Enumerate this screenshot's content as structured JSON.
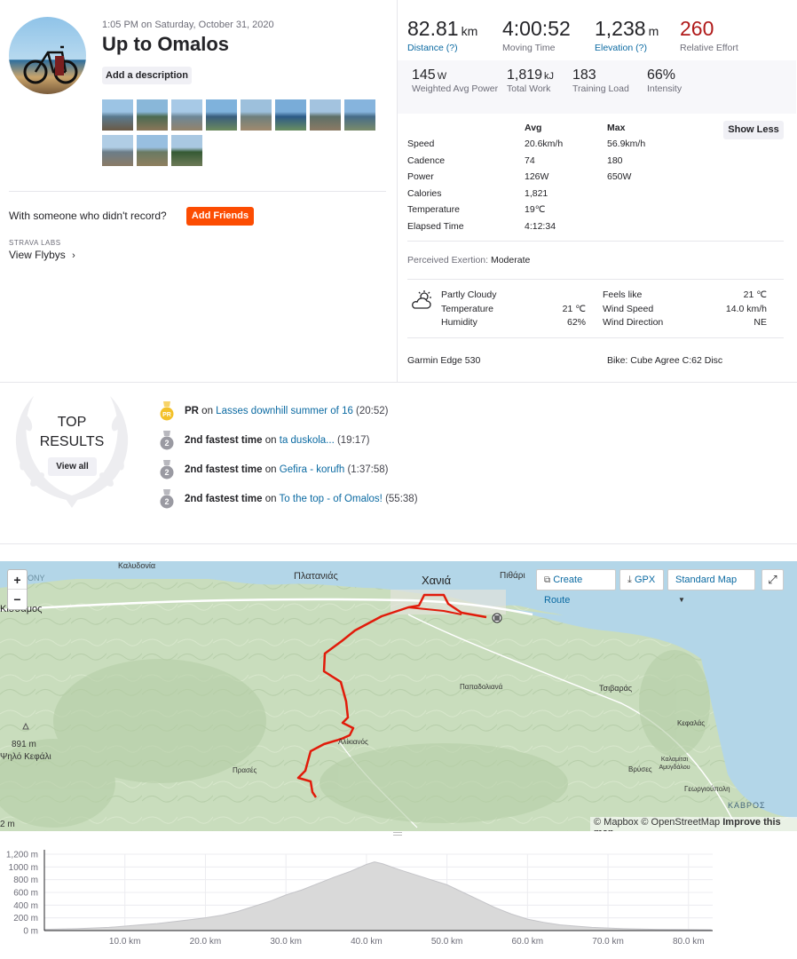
{
  "activity": {
    "datetime": "1:05 PM on Saturday, October 31, 2020",
    "title": "Up to Omalos",
    "add_description": "Add a description",
    "photo_count": 11
  },
  "friends": {
    "prompt": "With someone who didn't record?",
    "button": "Add Friends"
  },
  "labs": {
    "label": "STRAVA LABS",
    "flybys": "View Flybys"
  },
  "stats": {
    "distance": {
      "value": "82.81",
      "unit": "km",
      "label": "Distance (?)"
    },
    "moving_time": {
      "value": "4:00:52",
      "label": "Moving Time"
    },
    "elevation": {
      "value": "1,238",
      "unit": "m",
      "label": "Elevation (?)"
    },
    "relative_effort": {
      "value": "260",
      "label": "Relative Effort"
    },
    "weighted_power": {
      "value": "145",
      "unit": "W",
      "label": "Weighted Avg Power"
    },
    "total_work": {
      "value": "1,819",
      "unit": "kJ",
      "label": "Total Work"
    },
    "training_load": {
      "value": "183",
      "label": "Training Load"
    },
    "intensity": {
      "value": "66%",
      "label": "Intensity"
    }
  },
  "details": {
    "show_less": "Show Less",
    "col_avg": "Avg",
    "col_max": "Max",
    "rows": [
      {
        "label": "Speed",
        "avg": "20.6km/h",
        "max": "56.9km/h"
      },
      {
        "label": "Cadence",
        "avg": "74",
        "max": "180"
      },
      {
        "label": "Power",
        "avg": "126W",
        "max": "650W"
      },
      {
        "label": "Calories",
        "avg": "1,821",
        "max": ""
      },
      {
        "label": "Temperature",
        "avg": "19℃",
        "max": ""
      },
      {
        "label": "Elapsed Time",
        "avg": "4:12:34",
        "max": ""
      }
    ],
    "perceived_label": "Perceived Exertion:",
    "perceived_value": "Moderate"
  },
  "weather": {
    "condition": "Partly Cloudy",
    "temperature_label": "Temperature",
    "temperature": "21 ℃",
    "humidity_label": "Humidity",
    "humidity": "62%",
    "feels_like_label": "Feels like",
    "feels_like": "21 ℃",
    "wind_speed_label": "Wind Speed",
    "wind_speed": "14.0 km/h",
    "wind_dir_label": "Wind Direction",
    "wind_dir": "NE"
  },
  "device": "Garmin Edge 530",
  "bike": "Bike: Cube Agree C:62 Disc",
  "top_results": {
    "title_top": "TOP",
    "title_results": "RESULTS",
    "view_all": "View all",
    "items": [
      {
        "badge": "PR",
        "bold": "PR",
        "on": "on",
        "segment": "Lasses downhill summer of 16",
        "time": "(20:52)"
      },
      {
        "badge": "2",
        "bold": "2nd fastest time",
        "on": "on",
        "segment": "ta duskola...",
        "time": "(19:17)"
      },
      {
        "badge": "2",
        "bold": "2nd fastest time",
        "on": "on",
        "segment": "Gefira - korufh",
        "time": "(1:37:58)"
      },
      {
        "badge": "2",
        "bold": "2nd fastest time",
        "on": "on",
        "segment": "To the top - of Omalos!",
        "time": "(55:38)"
      }
    ]
  },
  "map": {
    "zoom_in": "+",
    "zoom_out": "−",
    "create_route": "Create Route",
    "gpx": "GPX",
    "map_style": "Standard Map",
    "labels": {
      "kaloudonia": "Καλυδονία",
      "platanias": "Πλατανιάς",
      "chania": "Χανιά",
      "pithari": "Πιθάρι",
      "kissamos": "Κίσσαμος",
      "papadoliana": "Παπαδολιανά",
      "tsivaras": "Τσιβαράς",
      "kefalas": "Κεφαλάς",
      "alikianos": "Αλίκιανός",
      "prases": "Πρασές",
      "vryses": "Βρύσες",
      "kalami": "Καλαμίτσι Αμυγδάλου",
      "georgioupoli": "Γεωργιούπολη",
      "kavros": "ΚΑΒΡΟΣ",
      "peak_height": "891 m",
      "peak_name": "Ψηλό Κεφάλι",
      "edge_m": "2 m",
      "edge_ny": "ΟΝΥ"
    },
    "attribution_1": "© Mapbox",
    "attribution_2": "© OpenStreetMap",
    "improve": "Improve this map"
  },
  "chart_data": {
    "type": "area",
    "x": [
      0,
      2,
      4,
      6,
      8,
      10,
      12,
      14,
      16,
      18,
      20,
      22,
      24,
      26,
      28,
      30,
      32,
      34,
      36,
      38,
      40,
      41,
      42,
      44,
      46,
      48,
      50,
      52,
      54,
      56,
      58,
      60,
      62,
      64,
      66,
      68,
      70,
      72,
      74,
      76,
      78,
      80,
      82.8
    ],
    "y": [
      20,
      25,
      30,
      40,
      50,
      70,
      90,
      110,
      140,
      170,
      200,
      240,
      300,
      380,
      460,
      560,
      640,
      740,
      840,
      930,
      1040,
      1080,
      1050,
      960,
      880,
      800,
      720,
      600,
      480,
      360,
      260,
      180,
      130,
      90,
      70,
      50,
      40,
      30,
      25,
      20,
      18,
      15,
      12
    ],
    "y_ticks": [
      "0 m",
      "200 m",
      "400 m",
      "600 m",
      "800 m",
      "1000 m",
      "1,200 m"
    ],
    "y_tick_values": [
      0,
      200,
      400,
      600,
      800,
      1000,
      1200
    ],
    "x_ticks": [
      "10.0 km",
      "20.0 km",
      "30.0 km",
      "40.0 km",
      "50.0 km",
      "60.0 km",
      "70.0 km",
      "80.0 km"
    ],
    "x_tick_values": [
      10,
      20,
      30,
      40,
      50,
      60,
      70,
      80
    ],
    "xlim": [
      0,
      83
    ],
    "ylim": [
      0,
      1200
    ],
    "grid": true,
    "fill_color": "#d9d9d9"
  }
}
